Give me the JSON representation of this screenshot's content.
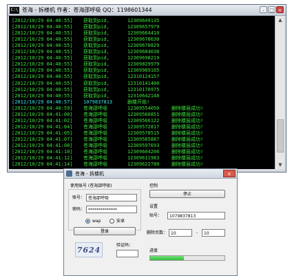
{
  "console": {
    "icon_text": "C:\\",
    "title": "苍海 - 拆楼机   作者：苍海邵呼吸   QQ：1198601344",
    "lines": [
      {
        "ts": "[2012/10/29 04:40:55]",
        "act": "获取到pid,",
        "num": "12309649135",
        "msg": ""
      },
      {
        "ts": "[2012/10/29 04:40:55]",
        "act": "获取到pid,",
        "num": "12309657979",
        "msg": ""
      },
      {
        "ts": "[2012/10/29 04:40:55]",
        "act": "获取到pid,",
        "num": "12309664410",
        "msg": ""
      },
      {
        "ts": "[2012/10/29 04:40:55]",
        "act": "获取到pid,",
        "num": "12309670630",
        "msg": ""
      },
      {
        "ts": "[2012/10/29 04:40:55]",
        "act": "获取到pid,",
        "num": "12309670829",
        "msg": ""
      },
      {
        "ts": "[2012/10/29 04:40:55]",
        "act": "获取到pid,",
        "num": "12309684038",
        "msg": ""
      },
      {
        "ts": "[2012/10/29 04:40:55]",
        "act": "获取到pid,",
        "num": "12309698219",
        "msg": ""
      },
      {
        "ts": "[2012/10/29 04:40:55]",
        "act": "获取到pid,",
        "num": "12309829979",
        "msg": ""
      },
      {
        "ts": "[2012/10/29 04:40:55]",
        "act": "获取到pid,",
        "num": "12309989105",
        "msg": ""
      },
      {
        "ts": "[2012/10/29 04:40:55]",
        "act": "获取到pid,",
        "num": "12310124157",
        "msg": ""
      },
      {
        "ts": "[2012/10/29 04:40:55]",
        "act": "获取到pid,",
        "num": "12310141400",
        "msg": ""
      },
      {
        "ts": "[2012/10/29 04:40:55]",
        "act": "获取到pid,",
        "num": "12310170975",
        "msg": ""
      },
      {
        "ts": "[2012/10/29 04:40:55]",
        "act": "获取到pid,",
        "num": "12310642148",
        "msg": ""
      },
      {
        "ts": "[2012/10/29 04:40:57]",
        "act": "1079837813",
        "num": "删楼开始!",
        "msg": "",
        "special": true
      },
      {
        "ts": "[2012/10/29 04:40:59]",
        "act": "苍海邵呼吸",
        "num": "12309554050",
        "msg": "删除楼层成功!"
      },
      {
        "ts": "[2012/10/29 04:41:00]",
        "act": "苍海邵呼吸",
        "num": "12309560851",
        "msg": "删除楼层成功!"
      },
      {
        "ts": "[2012/10/29 04:41:02]",
        "act": "苍海邵呼吸",
        "num": "12309566122",
        "msg": "删除楼层成功!"
      },
      {
        "ts": "[2012/10/29 04:41:04]",
        "act": "苍海邵呼吸",
        "num": "12309572817",
        "msg": "删除楼层成功!"
      },
      {
        "ts": "[2012/10/29 04:41:05]",
        "act": "苍海邵呼吸",
        "num": "12309578515",
        "msg": "删除楼层成功!"
      },
      {
        "ts": "[2012/10/29 04:41:07]",
        "act": "苍海邵呼吸",
        "num": "12309585887",
        "msg": "删除楼层成功!"
      },
      {
        "ts": "[2012/10/29 04:41:08]",
        "act": "苍海邵呼吸",
        "num": "12309597693",
        "msg": "删除楼层成功!"
      },
      {
        "ts": "[2012/10/29 04:41:10]",
        "act": "苍海邵呼吸",
        "num": "12309604206",
        "msg": "删除楼层成功!"
      },
      {
        "ts": "[2012/10/29 04:41:12]",
        "act": "苍海邵呼吸",
        "num": "12309611983",
        "msg": "删除楼层成功!"
      },
      {
        "ts": "[2012/10/29 04:41:14]",
        "act": "苍海邵呼吸",
        "num": "12309622780",
        "msg": "删除楼层成功!"
      }
    ]
  },
  "dialog": {
    "title": "苍海 - 拆楼机",
    "close_label": "x",
    "account_group_label": "使用账号 (苍海邵呼吸)",
    "account_label": "账号：",
    "account_value": "苍海邵呼吸",
    "password_label": "密码：",
    "password_value": "**************",
    "radio_wap": "wap",
    "radio_android": "安卓",
    "login_button": "登录",
    "captcha_text": "7624",
    "captcha_label": "验证码：",
    "captcha_value": "",
    "control_label": "控制",
    "stop_button": "停止",
    "settings_label": "设置",
    "tieba_label": "贴号：",
    "tieba_value": "1079837813",
    "pages_label": "删除页数：",
    "pages_from": "10",
    "pages_separator": "-",
    "pages_to": "10",
    "progress_label": "进度",
    "progress_fraction": 0.45
  }
}
